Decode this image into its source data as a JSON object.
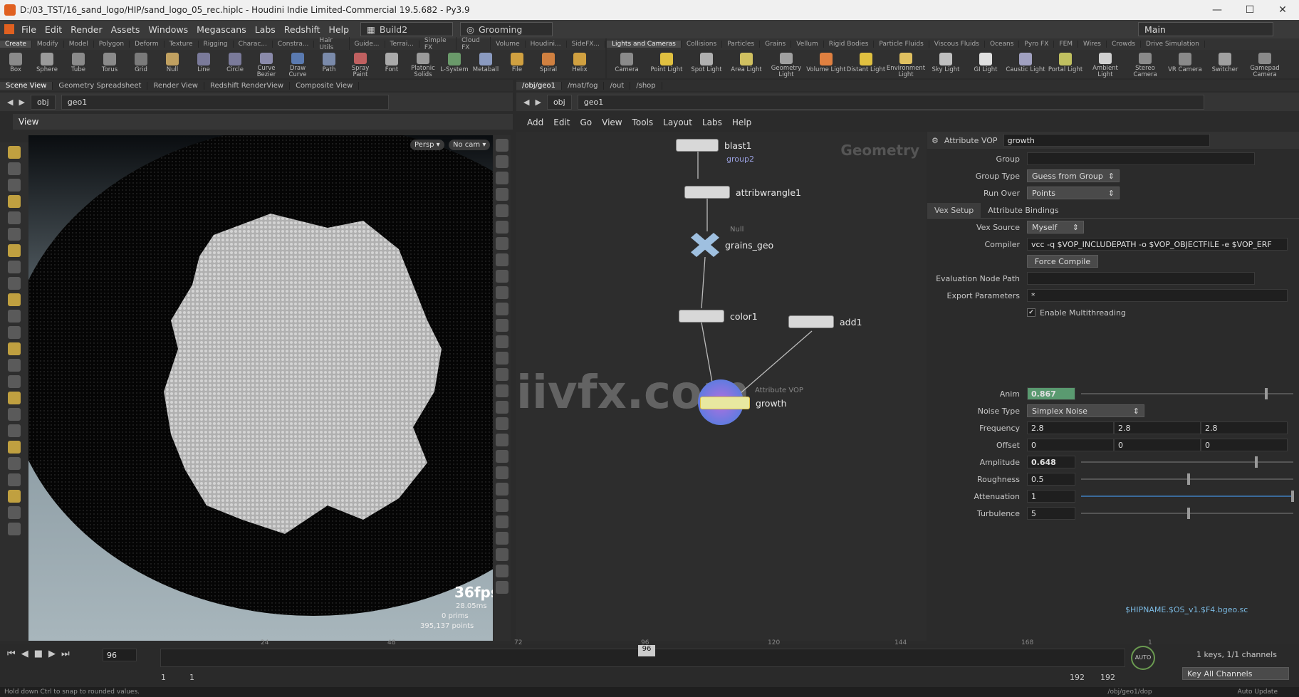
{
  "window": {
    "title": "D:/03_TST/16_sand_logo/HIP/sand_logo_05_rec.hiplc - Houdini Indie Limited-Commercial 19.5.682 - Py3.9",
    "min": "—",
    "max": "☐",
    "close": "✕"
  },
  "menubar": {
    "items": [
      "File",
      "Edit",
      "Render",
      "Assets",
      "Windows",
      "Megascans",
      "Labs",
      "Redshift",
      "Help"
    ],
    "build": "Build2",
    "grooming": "Grooming",
    "desktop": "Main"
  },
  "shelf_tabs_left": [
    "Create",
    "Modify",
    "Model",
    "Polygon",
    "Deform",
    "Texture",
    "Rigging",
    "Charac...",
    "Constra...",
    "Hair Utils",
    "Guide...",
    "Terrai...",
    "Simple FX",
    "Cloud FX",
    "Volume",
    "Houdini...",
    "SideFX..."
  ],
  "shelf_tabs_right": [
    "Lights and Cameras",
    "Collisions",
    "Particles",
    "Grains",
    "Vellum",
    "Rigid Bodies",
    "Particle Fluids",
    "Viscous Fluids",
    "Oceans",
    "Pyro FX",
    "FEM",
    "Wires",
    "Crowds",
    "Drive Simulation"
  ],
  "tools_left": [
    {
      "label": "Box",
      "color": "#8a8a8a"
    },
    {
      "label": "Sphere",
      "color": "#9a9a9a"
    },
    {
      "label": "Tube",
      "color": "#8a8a8a"
    },
    {
      "label": "Torus",
      "color": "#8a8a8a"
    },
    {
      "label": "Grid",
      "color": "#7a7a7a"
    },
    {
      "label": "Null",
      "color": "#c0a060"
    },
    {
      "label": "Line",
      "color": "#7a7a9a"
    },
    {
      "label": "Circle",
      "color": "#7a7a9a"
    },
    {
      "label": "Curve Bezier",
      "color": "#8a8aaa"
    },
    {
      "label": "Draw Curve",
      "color": "#5a7ab0"
    },
    {
      "label": "Path",
      "color": "#7a8aaa"
    },
    {
      "label": "Spray Paint",
      "color": "#c06060"
    },
    {
      "label": "Font",
      "color": "#aaaaaa"
    },
    {
      "label": "Platonic Solids",
      "color": "#9a9a9a"
    },
    {
      "label": "L-System",
      "color": "#6a9a6a"
    },
    {
      "label": "Metaball",
      "color": "#8a9ac0"
    },
    {
      "label": "File",
      "color": "#d0a040"
    },
    {
      "label": "Spiral",
      "color": "#d08040"
    },
    {
      "label": "Helix",
      "color": "#d0a040"
    }
  ],
  "tools_right": [
    {
      "label": "Camera",
      "color": "#8a8a8a"
    },
    {
      "label": "Point Light",
      "color": "#e0c040"
    },
    {
      "label": "Spot Light",
      "color": "#b0b0b0"
    },
    {
      "label": "Area Light",
      "color": "#d0c060"
    },
    {
      "label": "Geometry Light",
      "color": "#a0a0a0"
    },
    {
      "label": "Volume Light",
      "color": "#e08040"
    },
    {
      "label": "Distant Light",
      "color": "#e0c040"
    },
    {
      "label": "Environment Light",
      "color": "#e0c060"
    },
    {
      "label": "Sky Light",
      "color": "#c0c0c0"
    },
    {
      "label": "GI Light",
      "color": "#e0e0e0"
    },
    {
      "label": "Caustic Light",
      "color": "#a0a0c0"
    },
    {
      "label": "Portal Light",
      "color": "#c0c060"
    },
    {
      "label": "Ambient Light",
      "color": "#d0d0d0"
    },
    {
      "label": "Stereo Camera",
      "color": "#8a8a8a"
    },
    {
      "label": "VR Camera",
      "color": "#8a8a8a"
    },
    {
      "label": "Switcher",
      "color": "#a0a0a0"
    },
    {
      "label": "Gamepad Camera",
      "color": "#8a8a8a"
    }
  ],
  "left_pane_tabs": [
    "Scene View",
    "Geometry Spreadsheet",
    "Render View",
    "Redshift RenderView",
    "Composite View"
  ],
  "right_pane_tabs": [
    "/obj/geo1",
    "/mat/fog",
    "/out",
    "/shop"
  ],
  "path_left": {
    "obj": "obj",
    "geo": "geo1"
  },
  "path_right": {
    "obj": "obj",
    "geo": "geo1"
  },
  "viewport": {
    "label": "View",
    "persp": "Persp ▾",
    "cam": "No cam ▾",
    "fps": "36fps",
    "ms": "28.05ms",
    "prims": "0  prims",
    "points": "395,137 points"
  },
  "network_menu": [
    "Add",
    "Edit",
    "Go",
    "View",
    "Tools",
    "Layout",
    "Labs",
    "Help"
  ],
  "network_context": "Geometry",
  "watermark": "iivfx.com",
  "nodes": {
    "blast": "blast1",
    "blast_group": "group2",
    "wrangle": "attribwrangle1",
    "null_type": "Null",
    "null_name": "grains_geo",
    "color": "color1",
    "add": "add1",
    "vop_type": "Attribute VOP",
    "vop_name": "growth"
  },
  "params": {
    "op_type": "Attribute VOP",
    "op_name": "growth",
    "group_label": "Group",
    "group_value": "",
    "group_type_label": "Group Type",
    "group_type_value": "Guess from Group",
    "run_over_label": "Run Over",
    "run_over_value": "Points",
    "tabs": [
      "Vex Setup",
      "Attribute Bindings"
    ],
    "vex_source_label": "Vex Source",
    "vex_source_value": "Myself",
    "compiler_label": "Compiler",
    "compiler_value": "vcc -q $VOP_INCLUDEPATH -o $VOP_OBJECTFILE -e $VOP_ERF",
    "force_compile": "Force Compile",
    "eval_path_label": "Evaluation Node Path",
    "eval_path_value": "",
    "export_label": "Export Parameters",
    "export_value": "*",
    "multithread_label": "Enable Multithreading",
    "anim_label": "Anim",
    "anim_value": "0.867",
    "noise_label": "Noise Type",
    "noise_value": "Simplex Noise",
    "freq_label": "Frequency",
    "freq": [
      "2.8",
      "2.8",
      "2.8"
    ],
    "offset_label": "Offset",
    "offset": [
      "0",
      "0",
      "0"
    ],
    "amp_label": "Amplitude",
    "amp_value": "0.648",
    "rough_label": "Roughness",
    "rough_value": "0.5",
    "atten_label": "Attenuation",
    "atten_value": "1",
    "turb_label": "Turbulence",
    "turb_value": "5",
    "footer_path": "$HIPNAME.$OS_v1.$F4.bgeo.sc"
  },
  "timeline": {
    "frame": "96",
    "ticks": [
      "24",
      "48",
      "72",
      "96",
      "120",
      "144",
      "168",
      "1"
    ],
    "start": "1",
    "start2": "1",
    "end": "192",
    "end2": "192",
    "keys": "1 keys, 1/1 channels",
    "key_all": "Key All Channels",
    "auto": "AUTO"
  },
  "status": {
    "hint": "Hold down Ctrl to snap to rounded values.",
    "path": "/obj/geo1/dop",
    "update": "Auto Update"
  }
}
